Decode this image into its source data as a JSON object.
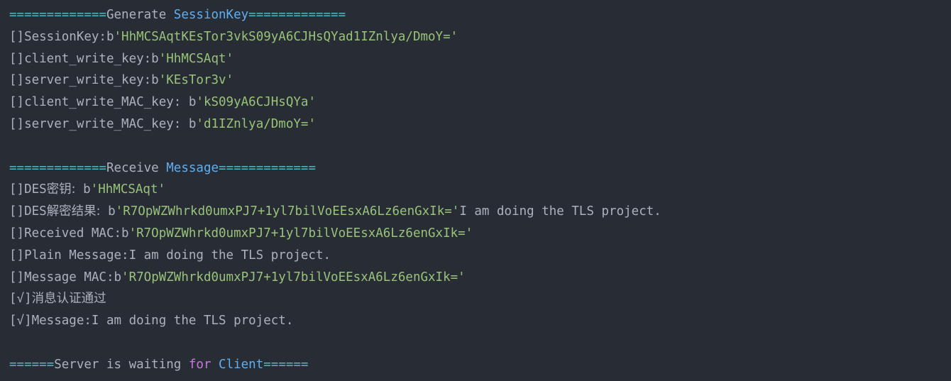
{
  "console": {
    "lines": [
      {
        "segments": [
          {
            "text": "=============",
            "color": "cyan"
          },
          {
            "text": "Generate ",
            "color": "plain"
          },
          {
            "text": "SessionKey",
            "color": "blue"
          },
          {
            "text": "=============",
            "color": "cyan"
          }
        ]
      },
      {
        "segments": [
          {
            "text": "[]SessionKey:b",
            "color": "plain"
          },
          {
            "text": "'HhMCSAqtKEsTor3vkS09yA6CJHsQYad1IZnlya/DmoY='",
            "color": "green"
          }
        ]
      },
      {
        "segments": [
          {
            "text": "[]client_write_key:b",
            "color": "plain"
          },
          {
            "text": "'HhMCSAqt'",
            "color": "green"
          }
        ]
      },
      {
        "segments": [
          {
            "text": "[]server_write_key:b",
            "color": "plain"
          },
          {
            "text": "'KEsTor3v'",
            "color": "green"
          }
        ]
      },
      {
        "segments": [
          {
            "text": "[]client_write_MAC_key: b",
            "color": "plain"
          },
          {
            "text": "'kS09yA6CJHsQYa'",
            "color": "green"
          }
        ]
      },
      {
        "segments": [
          {
            "text": "[]server_write_MAC_key: b",
            "color": "plain"
          },
          {
            "text": "'d1IZnlya/DmoY='",
            "color": "green"
          }
        ]
      },
      {
        "segments": []
      },
      {
        "segments": [
          {
            "text": "=============",
            "color": "cyan"
          },
          {
            "text": "Receive ",
            "color": "plain"
          },
          {
            "text": "Message",
            "color": "blue"
          },
          {
            "text": "=============",
            "color": "cyan"
          }
        ]
      },
      {
        "segments": [
          {
            "text": "[]DES",
            "color": "plain"
          },
          {
            "text": "密钥:",
            "color": "plain",
            "cjk": true
          },
          {
            "text": " b",
            "color": "plain"
          },
          {
            "text": "'HhMCSAqt'",
            "color": "green"
          }
        ]
      },
      {
        "segments": [
          {
            "text": "[]DES",
            "color": "plain"
          },
          {
            "text": "解密结果:",
            "color": "plain",
            "cjk": true
          },
          {
            "text": " b",
            "color": "plain"
          },
          {
            "text": "'R7OpWZWhrkd0umxPJ7+1yl7bilVoEEsxA6Lz6enGxIk='",
            "color": "green"
          },
          {
            "text": "I am doing the TLS project.",
            "color": "plain"
          }
        ]
      },
      {
        "segments": [
          {
            "text": "[]Received MAC:b",
            "color": "plain"
          },
          {
            "text": "'R7OpWZWhrkd0umxPJ7+1yl7bilVoEEsxA6Lz6enGxIk='",
            "color": "green"
          }
        ]
      },
      {
        "segments": [
          {
            "text": "[]Plain Message:I am doing the TLS project.",
            "color": "plain"
          }
        ]
      },
      {
        "segments": [
          {
            "text": "[]Message MAC:b",
            "color": "plain"
          },
          {
            "text": "'R7OpWZWhrkd0umxPJ7+1yl7bilVoEEsxA6Lz6enGxIk='",
            "color": "green"
          }
        ]
      },
      {
        "segments": [
          {
            "text": "[√]",
            "color": "plain"
          },
          {
            "text": "消息认证通过",
            "color": "plain",
            "cjk": true
          }
        ]
      },
      {
        "segments": [
          {
            "text": "[√]Message:I am doing the TLS project.",
            "color": "plain"
          }
        ]
      },
      {
        "segments": []
      },
      {
        "segments": [
          {
            "text": "======",
            "color": "cyan"
          },
          {
            "text": "Server is waiting ",
            "color": "plain"
          },
          {
            "text": "for",
            "color": "purple"
          },
          {
            "text": " ",
            "color": "plain"
          },
          {
            "text": "Client",
            "color": "blue"
          },
          {
            "text": "======",
            "color": "cyan"
          }
        ]
      }
    ]
  },
  "theme": {
    "background": "#282c34",
    "plain": "#abb2bf",
    "cyan": "#56b6c2",
    "blue": "#61afef",
    "green": "#98c379",
    "purple": "#c678dd"
  }
}
